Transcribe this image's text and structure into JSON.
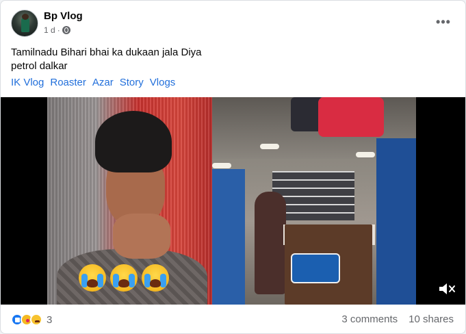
{
  "post": {
    "author": "Bp Vlog",
    "time": "1 d",
    "audience_icon": "globe-icon",
    "more_icon": "more-options-icon",
    "text_line1": "Tamilnadu Bihari bhai ka dukaan jala Diya",
    "text_line2": "petrol dalkar",
    "tags": [
      "IK Vlog",
      "Roaster",
      "Azar",
      "Story",
      "Vlogs"
    ],
    "link_color": "#216fdb"
  },
  "video": {
    "overlay_emojis": [
      "loudly-crying-face",
      "loudly-crying-face",
      "loudly-crying-face"
    ],
    "mute_icon": "volume-muted-icon"
  },
  "footer": {
    "reaction_icons": [
      "like-icon",
      "care-icon",
      "sad-icon"
    ],
    "reaction_count": "3",
    "comments": "3 comments",
    "shares": "10 shares"
  }
}
